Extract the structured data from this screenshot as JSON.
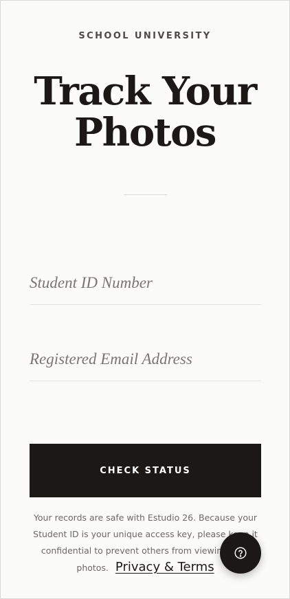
{
  "brand": {
    "name": "SCHOOL UNIVERSITY"
  },
  "hero": {
    "title_line1": "Track Your",
    "title_line2": "Photos"
  },
  "form": {
    "student_id_placeholder": "Student ID Number",
    "email_placeholder": "Registered Email Address",
    "submit_label": "CHECK STATUS"
  },
  "notice": {
    "text": "Your records are safe with Estudio 26. Because your Student ID is your unique access key, please keep it confidential to prevent others from viewing your photos.",
    "link_label": "Privacy & Terms"
  },
  "help": {
    "icon": "help-circle-icon"
  },
  "colors": {
    "background": "#fbfbf9",
    "primary": "#1c1816",
    "muted_text": "#6d6865"
  }
}
